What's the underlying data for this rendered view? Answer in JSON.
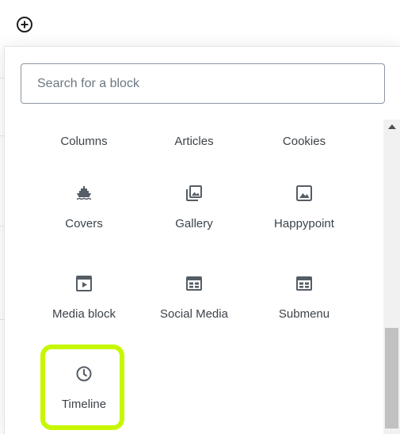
{
  "toolbar": {
    "add_block_icon": "plus-circle-icon"
  },
  "inserter": {
    "search": {
      "placeholder": "Search for a block",
      "value": ""
    },
    "blocks": [
      {
        "label": "Columns",
        "icon": null
      },
      {
        "label": "Articles",
        "icon": null
      },
      {
        "label": "Cookies",
        "icon": null
      },
      {
        "label": "Covers",
        "icon": "ship-icon"
      },
      {
        "label": "Gallery",
        "icon": "gallery-icon"
      },
      {
        "label": "Happypoint",
        "icon": "image-icon"
      },
      {
        "label": "Media block",
        "icon": "video-icon"
      },
      {
        "label": "Social Media",
        "icon": "layout-icon"
      },
      {
        "label": "Submenu",
        "icon": "layout-icon"
      },
      {
        "label": "Timeline",
        "icon": "clock-icon",
        "highlighted": true
      }
    ]
  },
  "colors": {
    "highlight": "#c6f700",
    "icon": "#555d66",
    "label": "#3c434a"
  }
}
